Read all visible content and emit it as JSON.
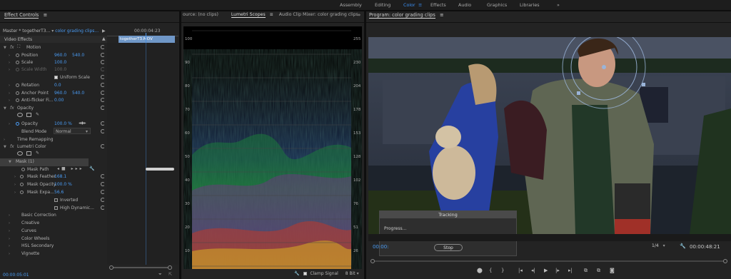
{
  "workspaces": {
    "tabs": [
      {
        "label": "Assembly"
      },
      {
        "label": "Editing"
      },
      {
        "label": "Color"
      },
      {
        "label": "Effects"
      },
      {
        "label": "Audio"
      },
      {
        "label": "Graphics"
      },
      {
        "label": "Libraries"
      }
    ],
    "more": "»"
  },
  "effect_controls": {
    "title": "Effect Controls",
    "menu": "≡",
    "master": "Master * togetherT3...",
    "clip": "color grading clips...",
    "timecode_ruler": "00:00:04:23",
    "clip_block": "togetherT3.MOV",
    "video_effects": "Video Effects",
    "motion": {
      "label": "Motion",
      "position": {
        "label": "Position",
        "x": "960.0",
        "y": "540.0"
      },
      "scale": {
        "label": "Scale",
        "value": "100.0"
      },
      "scale_width": {
        "label": "Scale Width",
        "value": "100.0"
      },
      "uniform_scale": "Uniform Scale",
      "rotation": {
        "label": "Rotation",
        "value": "0.0"
      },
      "anchor_point": {
        "label": "Anchor Point",
        "x": "960.0",
        "y": "540.0"
      },
      "anti_flicker": {
        "label": "Anti-flicker Fi...",
        "value": "0.00"
      }
    },
    "opacity": {
      "label": "Opacity",
      "opacity": {
        "label": "Opacity",
        "value": "100.0 %"
      },
      "blend_mode": {
        "label": "Blend Mode",
        "value": "Normal"
      }
    },
    "time_remapping": "Time Remapping",
    "lumetri": {
      "label": "Lumetri Color",
      "mask": "Mask (1)",
      "mask_path": "Mask Path",
      "mask_feather": {
        "label": "Mask Feather",
        "value": "168.1"
      },
      "mask_opacity": {
        "label": "Mask Opacity",
        "value": "100.0 %"
      },
      "mask_expansion": {
        "label": "Mask Expa...",
        "value": "56.6"
      },
      "inverted": "Inverted",
      "high_dynamic": "High Dynamic..."
    },
    "sections": [
      {
        "label": "Basic Correction"
      },
      {
        "label": "Creative"
      },
      {
        "label": "Curves"
      },
      {
        "label": "Color Wheels"
      },
      {
        "label": "HSL Secondary"
      },
      {
        "label": "Vignette"
      }
    ],
    "timecode": "00:00:05:01"
  },
  "scopes": {
    "source_tab": "ource: (no clips)",
    "lumetri_tab": "Lumetri Scopes",
    "audio_tab": "Audio Clip Mixer: color grading clips",
    "left_scale": [
      "100",
      "90",
      "80",
      "70",
      "60",
      "50",
      "40",
      "30",
      "20",
      "10",
      "0"
    ],
    "right_scale": [
      "255",
      "230",
      "204",
      "178",
      "153",
      "128",
      "102",
      "76",
      "51",
      "26",
      "0"
    ],
    "clamp_signal": "Clamp Signal",
    "bit_depth": "8 Bit"
  },
  "program": {
    "title": "Program: color grading clips",
    "menu": "≡",
    "timecode_left": "00:00:",
    "timecode_right": "00:00:48:21",
    "resolution": "1/4",
    "tracking": {
      "title": "Tracking",
      "progress_label": "Progress...",
      "progress": 0.46,
      "stop": "Stop"
    }
  },
  "colors": {
    "accent": "#3b8ff2",
    "value_blue": "#4a9cf5",
    "panel_bg": "#232323",
    "playhead": "#4a8fe0"
  }
}
